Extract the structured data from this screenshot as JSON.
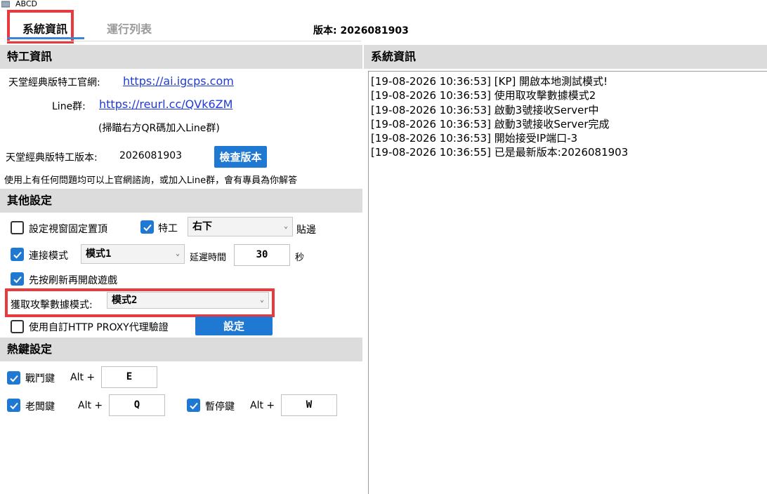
{
  "window": {
    "title": "ABCD"
  },
  "tabs": [
    {
      "label": "系統資訊",
      "active": true
    },
    {
      "label": "運行列表",
      "active": false
    }
  ],
  "version_header": "版本: 2026081903",
  "agent_info": {
    "header": "特工資訊",
    "site_label": "天堂經典版特工官網:",
    "site_url": "https://ai.igcps.com",
    "line_label": "Line群:",
    "line_url": "https://reurl.cc/QVk6ZM",
    "qr_hint": "(掃瞄右方QR碼加入Line群)",
    "version_label": "天堂經典版特工版本:",
    "version_value": "2026081903",
    "check_version_button": "檢查版本",
    "help_text": "使用上有任何問題均可以上官網諮詢，或加入Line群，會有專員為你解答"
  },
  "other_settings": {
    "header": "其他設定",
    "pin_window_label": "設定視窗固定置頂",
    "pin_window_checked": false,
    "agent_label": "特工",
    "agent_checked": true,
    "agent_position": "右下",
    "agent_suffix": "貼邊",
    "connect_mode_label": "連接模式",
    "connect_mode_checked": true,
    "connect_mode_value": "模式1",
    "delay_label": "延遲時間",
    "delay_value": "30",
    "delay_unit": "秒",
    "refresh_label": "先按刷新再開啟遊戲",
    "refresh_checked": true,
    "attack_data_label": "獲取攻擊數據模式:",
    "attack_data_value": "模式2",
    "proxy_label": "使用自訂HTTP PROXY代理驗證",
    "proxy_checked": false,
    "proxy_button": "設定"
  },
  "hotkeys": {
    "header": "熱鍵設定",
    "battle_label": "戰鬥鍵",
    "battle_checked": true,
    "battle_mod": "Alt +",
    "battle_key": "E",
    "boss_label": "老闆鍵",
    "boss_checked": true,
    "boss_mod": "Alt +",
    "boss_key": "Q",
    "pause_label": "暫停鍵",
    "pause_checked": true,
    "pause_mod": "Alt +",
    "pause_key": "W"
  },
  "system_info": {
    "header": "系統資訊",
    "log": [
      "[19-08-2026 10:36:53] [KP] 開啟本地測試模式!",
      "[19-08-2026 10:36:53] 使用取攻擊數據模式2",
      "[19-08-2026 10:36:53] 啟動3號接收Server中",
      "[19-08-2026 10:36:53] 啟動3號接收Server完成",
      "[19-08-2026 10:36:53] 開始接受IP端口-3",
      "[19-08-2026 10:36:55] 已是最新版本:2026081903"
    ]
  },
  "colors": {
    "accent": "#1f78d1",
    "highlight_box": "#e8393d",
    "section_bg": "#dcdcdc",
    "link": "#1f3bd6"
  }
}
